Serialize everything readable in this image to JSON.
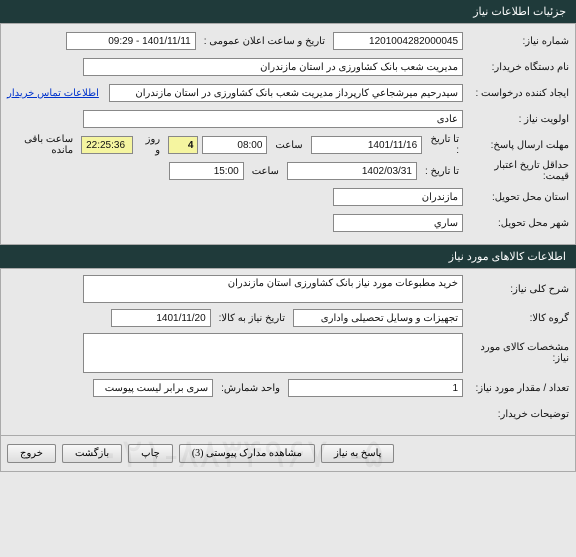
{
  "sections": {
    "need_details": "جزئیات اطلاعات نیاز",
    "goods_details": "اطلاعات کالاهای مورد نیاز"
  },
  "top": {
    "req_number_label": "شماره نیاز:",
    "req_number": "1201004282000045",
    "announce_label": "تاریخ و ساعت اعلان عمومی :",
    "announce_value": "1401/11/11 - 09:29",
    "buyer_label": "نام دستگاه خریدار:",
    "buyer_value": "مدیریت شعب بانک کشاورزی در استان مازندران",
    "creator_label": "ایجاد کننده درخواست :",
    "creator_value": "سيدرحيم ميرشجاعي كارپرداز مدیریت شعب بانک کشاورزی در استان مازندران",
    "contact_link": "اطلاعات تماس خریدار",
    "priority_label": "اولویت نیاز :",
    "priority_value": "عادی",
    "deadline_label": "مهلت ارسال پاسخ:",
    "deadline_to": "تا تاریخ :",
    "deadline_date": "1401/11/16",
    "time_label": "ساعت",
    "deadline_time": "08:00",
    "days": "4",
    "days_label": "روز و",
    "countdown": "22:25:36",
    "remain_label": "ساعت باقی مانده",
    "validity_label": "حداقل تاریخ اعتبار قیمت:",
    "validity_date": "1402/03/31",
    "validity_time": "15:00",
    "province_label": "استان محل تحویل:",
    "province": "مازندران",
    "city_label": "شهر محل تحویل:",
    "city": "ساري"
  },
  "goods": {
    "desc_label": "شرح کلی نیاز:",
    "desc_value": "خرید مطبوعات مورد نیاز بانک کشاورزی  استان مازندران",
    "group_label": "گروه کالا:",
    "group_value": "تجهیزات و وسایل تحصیلی واداری",
    "need_date_label": "تاریخ نیاز به کالا:",
    "need_date": "1401/11/20",
    "spec_label": "مشخصات کالای مورد نیاز:",
    "spec_value": "",
    "qty_label": "تعداد / مقدار مورد نیاز:",
    "qty_value": "1",
    "unit_label": "واحد شمارش:",
    "unit_value": "سری برابر لیست پیوست",
    "buyer_notes_label": "توضیحات خریدار:"
  },
  "footer": {
    "respond": "پاسخ به نیاز",
    "attachments": "مشاهده مدارک پیوستی (3)",
    "print": "چاپ",
    "back": "بازگشت",
    "exit": "خروج"
  },
  "watermark": "۰۲۱-۸۸۳۴۹۶۷۰-۵"
}
